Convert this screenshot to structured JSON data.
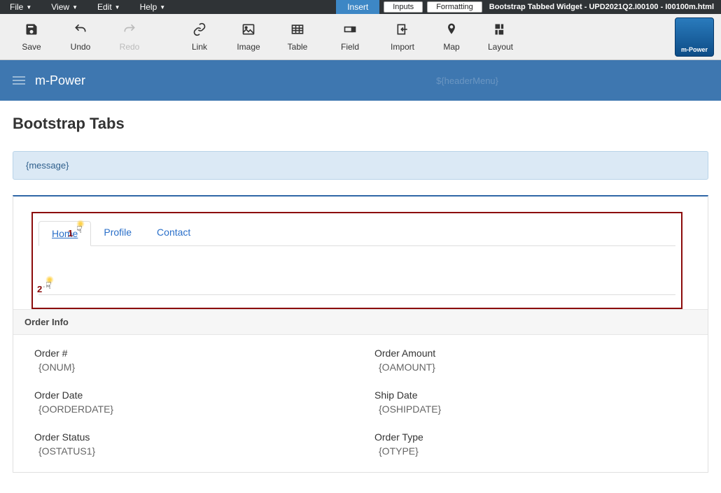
{
  "menubar": {
    "file": "File",
    "view": "View",
    "edit": "Edit",
    "help": "Help",
    "insert": "Insert",
    "inputs": "Inputs",
    "formatting": "Formatting",
    "title": "Bootstrap Tabbed Widget - UPD2021Q2.I00100 - I00100m.html"
  },
  "toolbar": {
    "save": "Save",
    "undo": "Undo",
    "redo": "Redo",
    "link": "Link",
    "image": "Image",
    "table": "Table",
    "field": "Field",
    "import": "Import",
    "map": "Map",
    "layout": "Layout",
    "logo": "m-Power"
  },
  "bluebar": {
    "brand": "m-Power",
    "headerMenu": "${headerMenu}"
  },
  "page": {
    "title": "Bootstrap Tabs",
    "message": "{message}"
  },
  "tabs": {
    "home": "Home",
    "profile": "Profile",
    "contact": "Contact"
  },
  "annotations": {
    "num1": "1",
    "num2": "2"
  },
  "orderInfo": {
    "heading": "Order Info",
    "fields": [
      {
        "label": "Order #",
        "value": "{ONUM}"
      },
      {
        "label": "Order Amount",
        "value": "{OAMOUNT}"
      },
      {
        "label": "Order Date",
        "value": "{OORDERDATE}"
      },
      {
        "label": "Ship Date",
        "value": "{OSHIPDATE}"
      },
      {
        "label": "Order Status",
        "value": "{OSTATUS1}"
      },
      {
        "label": "Order Type",
        "value": "{OTYPE}"
      }
    ]
  },
  "dots": "..."
}
